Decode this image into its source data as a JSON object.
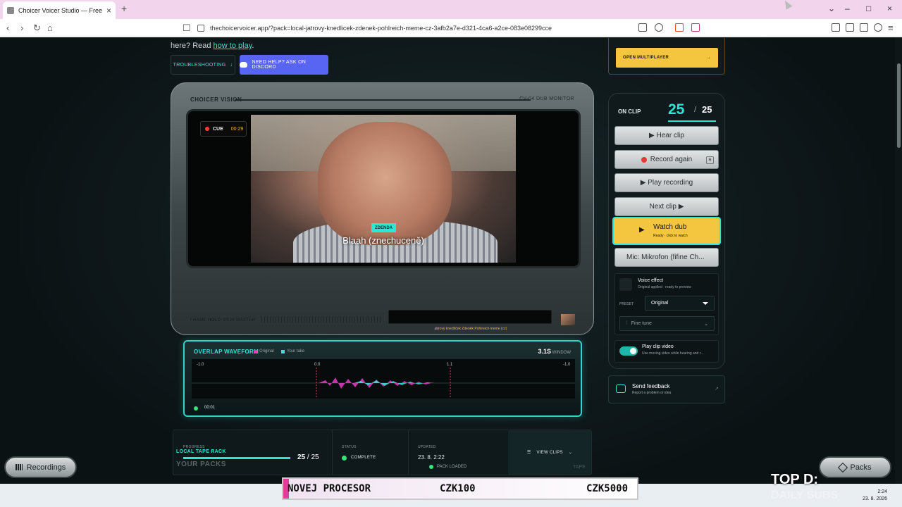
{
  "browser": {
    "tab_title": "Choicer Voicer Studio — Free Onl",
    "url": "thechoicervoicer.app/?pack=local-jatrovy-knedlicek-zdenek-pohlreich-meme-cz-3afb2a7e-d321-4ca6-a2ce-083e08299cce"
  },
  "intro": {
    "prefix": "here? Read ",
    "link": "how to play",
    "suffix": "."
  },
  "buttons": {
    "troubleshooting": "TROUBLESHOOTING",
    "discord": "NEED HELP? ASK ON DISCORD",
    "multiplayer": "OPEN MULTIPLAYER"
  },
  "tv": {
    "title": "CHOICER VISION",
    "model": "CV-04 DUB MONITOR",
    "cue_label": "CUE",
    "cue_time": "00:29",
    "speaker": "ZDENDA",
    "subtitle": "Blaah (znechuceně)",
    "frame_hold": "FRAME HOLD",
    "master": "00:26 MASTER",
    "caption": "játrový knedlíček Zdeněk Pohlreich meme (cz)"
  },
  "waveform": {
    "title": "OVERLAP WAVEFORM",
    "legend_original": "Original",
    "legend_take": "Your take",
    "window_value": "3.1S",
    "window_label": "WINDOW",
    "ticks": [
      "-1.0",
      "0.0",
      "1.1",
      "-1.0"
    ],
    "time": "00:01",
    "colors": {
      "original": "#e83cc8",
      "take": "#2ee6d6"
    }
  },
  "stats": {
    "progress_label": "PROGRESS",
    "progress_fraction": 1.0,
    "progress_current": "25",
    "progress_total": "25",
    "status_label": "STATUS",
    "status_value": "COMPLETE",
    "updated_label": "UPDATED",
    "updated_value": "23. 8. 2:22",
    "view_clips": "VIEW CLIPS"
  },
  "library": {
    "tape_label": "LOCAL TAPE RACK",
    "packs_title": "YOUR PACKS",
    "pack_loaded": "PACK LOADED",
    "side_note": "TAPE"
  },
  "controls": {
    "on_clip": "ON CLIP",
    "clip_current": "25",
    "clip_total": "25",
    "hear_clip": "▶ Hear clip",
    "record_again": "Record again",
    "record_key": "R",
    "play_recording": "▶ Play recording",
    "next_clip": "Next clip ▶",
    "watch_dub": "Watch dub",
    "watch_dub_sub": "Ready · click to watch",
    "mic": "Mic: Mikrofon (fifine Ch...",
    "voice_effect": "Voice effect",
    "voice_effect_sub": "Original applied · ready to preview",
    "preset_label": "PRESET",
    "preset_value": "Original",
    "fine_tune": "Fine tune",
    "play_clip_video": "Play clip video",
    "play_clip_video_sub": "Use moving video while hearing and r..."
  },
  "feedback": {
    "title": "Send feedback",
    "sub": "Report a problem or idea"
  },
  "floating": {
    "recordings": "Recordings",
    "packs": "Packs"
  },
  "overlay": {
    "ad_left": "NOVEJ PROCESOR",
    "ad_mid": "CZK100",
    "ad_right": "CZK5000",
    "top_d": "TOP D:",
    "daily": "DAILY SUBS",
    "clock_time": "2:24",
    "clock_date": "23. 8. 2026"
  },
  "accent": "#2ee6d6",
  "gold": "#f4c53e"
}
